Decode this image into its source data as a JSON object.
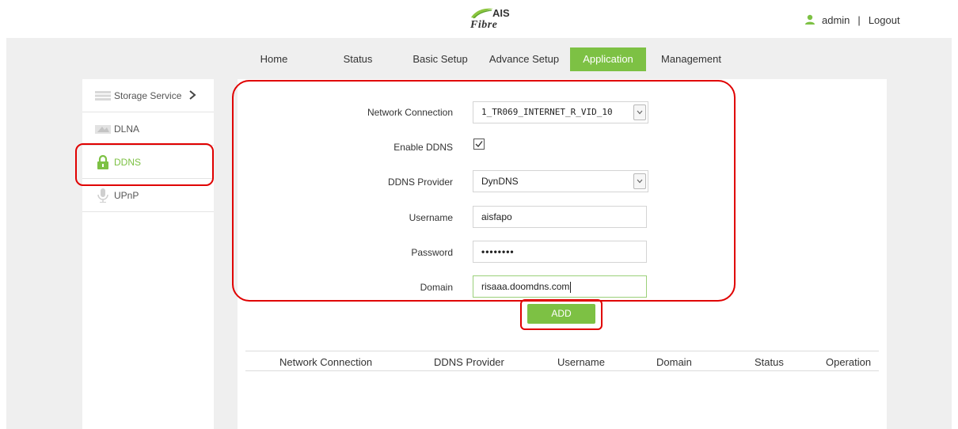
{
  "header": {
    "logo_top": "AIS",
    "logo_bottom": "Fibre",
    "user": "admin",
    "separator": "|",
    "logout": "Logout"
  },
  "nav": {
    "items": [
      "Home",
      "Status",
      "Basic Setup",
      "Advance Setup",
      "Application",
      "Management"
    ],
    "active": "Application"
  },
  "sidebar": {
    "items": [
      {
        "label": "Storage Service",
        "icon": "storage-icon"
      },
      {
        "label": "DLNA",
        "icon": "dlna-icon"
      },
      {
        "label": "DDNS",
        "icon": "lock-icon",
        "active": true
      },
      {
        "label": "UPnP",
        "icon": "microphone-icon"
      }
    ]
  },
  "form": {
    "network_connection_label": "Network Connection",
    "network_connection_value": "1_TR069_INTERNET_R_VID_10",
    "enable_ddns_label": "Enable DDNS",
    "enable_ddns_checked": true,
    "ddns_provider_label": "DDNS Provider",
    "ddns_provider_value": "DynDNS",
    "username_label": "Username",
    "username_value": "aisfapo",
    "password_label": "Password",
    "password_value": "••••••••",
    "domain_label": "Domain",
    "domain_value": "risaaa.doomdns.com",
    "add_button": "ADD"
  },
  "table": {
    "headers": [
      "Network Connection",
      "DDNS Provider",
      "Username",
      "Domain",
      "Status",
      "Operation"
    ],
    "rows": []
  },
  "colors": {
    "accent": "#7dc144",
    "annotation": "#e00000",
    "background": "#efefef"
  }
}
